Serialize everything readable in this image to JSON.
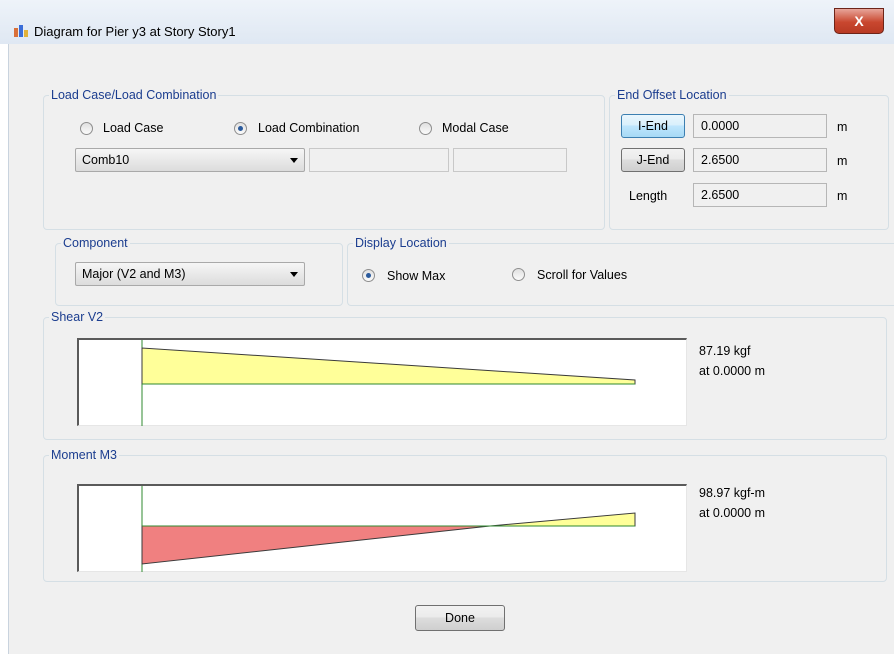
{
  "window": {
    "title": "Diagram for Pier y3 at Story Story1",
    "close_label": "X"
  },
  "load_case": {
    "legend": "Load Case/Load Combination",
    "options": [
      "Load Case",
      "Load Combination",
      "Modal Case"
    ],
    "selected": "Load Combination",
    "combo_value": "Comb10"
  },
  "end_offset": {
    "legend": "End Offset Location",
    "i_end_label": "I-End",
    "i_end_value": "0.0000",
    "j_end_label": "J-End",
    "j_end_value": "2.6500",
    "length_label": "Length",
    "length_value": "2.6500",
    "unit": "m"
  },
  "component": {
    "legend": "Component",
    "value": "Major (V2 and M3)"
  },
  "display_location": {
    "legend": "Display Location",
    "options": [
      "Show Max",
      "Scroll for Values"
    ],
    "selected": "Show Max"
  },
  "shear": {
    "legend": "Shear V2",
    "max_value": "87.19 kgf",
    "location": "at 0.0000 m"
  },
  "moment": {
    "legend": "Moment M3",
    "max_value": "98.97 kgf-m",
    "location": "at 0.0000 m"
  },
  "done_label": "Done",
  "colors": {
    "positive": "#ffff99",
    "negative": "#f08080",
    "axis": "#2f8a2f",
    "legend_text": "#1b3d8f"
  }
}
